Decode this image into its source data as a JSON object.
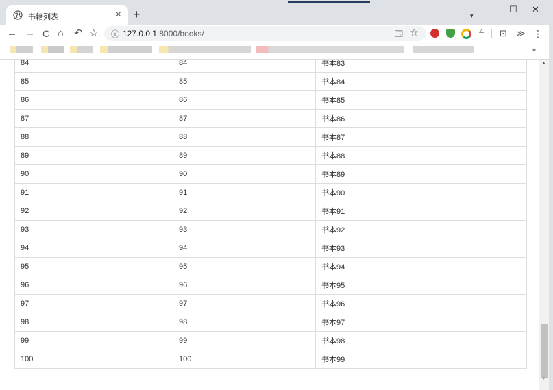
{
  "tab": {
    "title": "书籍列表",
    "close": "×",
    "new_tab": "+"
  },
  "window": {
    "tab_search": "▾",
    "minimize": "–",
    "maximize": "☐",
    "close": "✕"
  },
  "toolbar": {
    "back": "←",
    "forward": "→",
    "reload": "C",
    "home": "⌂",
    "undo": "↶",
    "bookmark": "☆",
    "info_icon": "ⓘ",
    "url_host": "127.0.0.1",
    "url_path": ":8000/books/",
    "translate": "🗔",
    "star": "☆",
    "crop": "⊡",
    "more_ext": "≫",
    "menu": "⋮",
    "bolt": "≜"
  },
  "bookmarks": {
    "more": "»"
  },
  "colors": {
    "accent_abp": "#d32f2f",
    "shield": "#43a047",
    "border": "#dddddd"
  },
  "books": [
    {
      "index": "84",
      "id": "84",
      "name": "书本83"
    },
    {
      "index": "85",
      "id": "85",
      "name": "书本84"
    },
    {
      "index": "86",
      "id": "86",
      "name": "书本85"
    },
    {
      "index": "87",
      "id": "87",
      "name": "书本86"
    },
    {
      "index": "88",
      "id": "88",
      "name": "书本87"
    },
    {
      "index": "89",
      "id": "89",
      "name": "书本88"
    },
    {
      "index": "90",
      "id": "90",
      "name": "书本89"
    },
    {
      "index": "91",
      "id": "91",
      "name": "书本90"
    },
    {
      "index": "92",
      "id": "92",
      "name": "书本91"
    },
    {
      "index": "93",
      "id": "93",
      "name": "书本92"
    },
    {
      "index": "94",
      "id": "94",
      "name": "书本93"
    },
    {
      "index": "95",
      "id": "95",
      "name": "书本94"
    },
    {
      "index": "96",
      "id": "96",
      "name": "书本95"
    },
    {
      "index": "97",
      "id": "97",
      "name": "书本96"
    },
    {
      "index": "98",
      "id": "98",
      "name": "书本97"
    },
    {
      "index": "99",
      "id": "99",
      "name": "书本98"
    },
    {
      "index": "100",
      "id": "100",
      "name": "书本99"
    }
  ]
}
